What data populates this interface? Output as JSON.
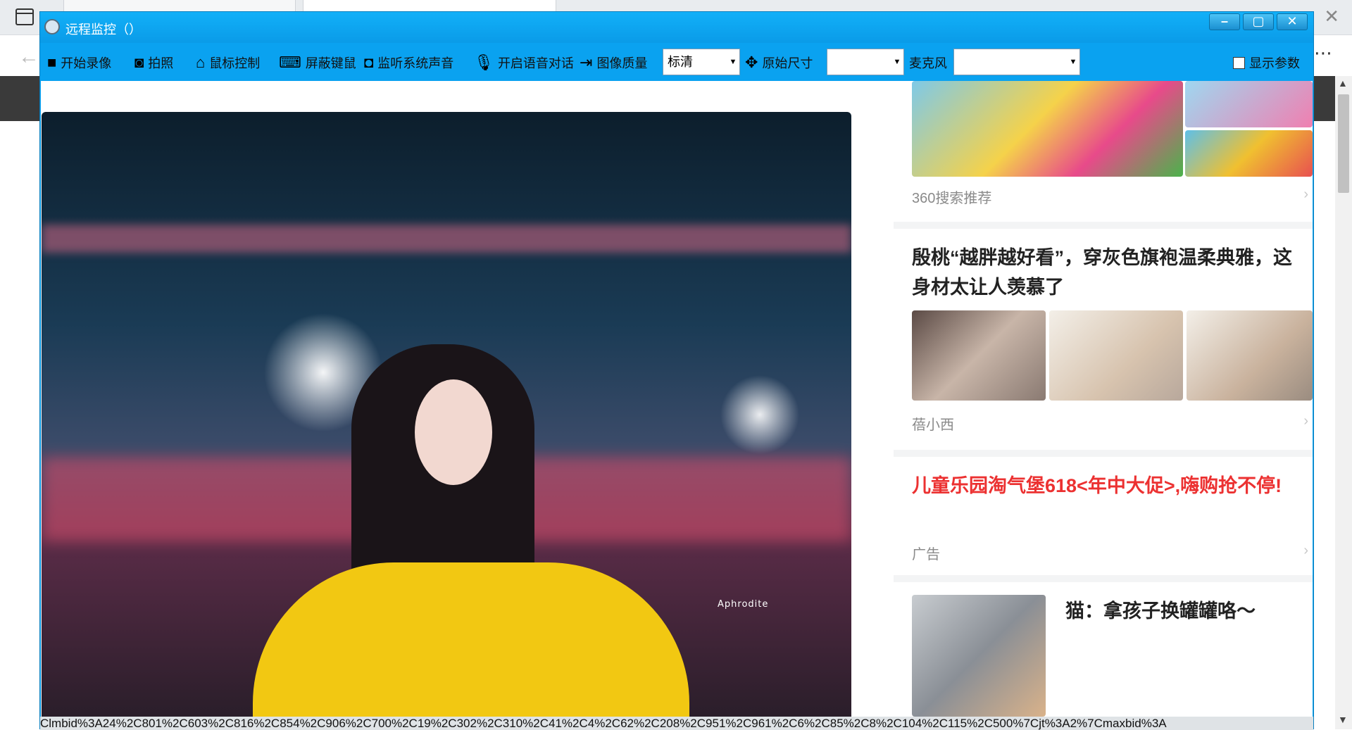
{
  "window": {
    "title": "远程监控（）",
    "minimize_glyph": "–",
    "maximize_glyph": "▢",
    "close_glyph": "✕"
  },
  "toolbar": {
    "record_label": "开始录像",
    "photo_label": "拍照",
    "mouse_control_label": "鼠标控制",
    "block_input_label": "屏蔽键鼠",
    "listen_audio_label": "监听系统声音",
    "voice_chat_label": "开启语音对话",
    "quality_label": "图像质量",
    "quality_value": "标清",
    "original_size_label": "原始尺寸",
    "size_value": "",
    "mic_label": "麦克风",
    "mic_value": "",
    "show_params_label": "显示参数",
    "more_glyph": "⋯"
  },
  "feed": {
    "photo_watermark": "Aphrodite",
    "card1_source": "360搜索推荐",
    "card2_title": "殷桃“越胖越好看”，穿灰色旗袍温柔典雅，这身材太让人羡慕了",
    "card2_source": "蓓小西",
    "card3_title": "儿童乐园淘气堡618<年中大促>,嗨购抢不停!",
    "card3_source": "广告",
    "card4_title": "猫：拿孩子换罐罐咯～"
  },
  "status": {
    "url_text": "Clmbid%3A24%2C801%2C603%2C816%2C854%2C906%2C700%2C19%2C302%2C310%2C41%2C4%2C62%2C208%2C951%2C961%2C6%2C85%2C8%2C104%2C115%2C500%7Cjt%3A2%7Cmaxbid%3A"
  },
  "colors": {
    "window_blue": "#0aa2f0",
    "ad_red": "#ec3131"
  }
}
